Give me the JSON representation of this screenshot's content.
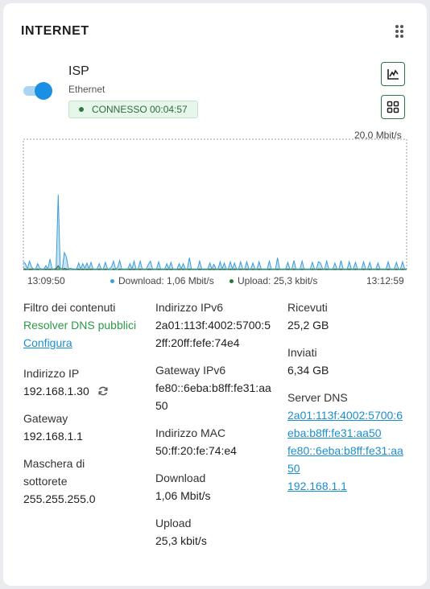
{
  "card": {
    "title": "INTERNET",
    "menu_icon": "more-vertical-icon"
  },
  "connection": {
    "name": "ISP",
    "type": "Ethernet",
    "status": "CONNESSO 00:04:57",
    "enabled": true,
    "colors": {
      "status_text": "#2f6b3e",
      "status_bg": "#e6f6ea",
      "toggle": "#1a8fe3"
    }
  },
  "actions": {
    "chart_icon": "line-chart-icon",
    "grid_icon": "grid-view-icon"
  },
  "chart_data": {
    "type": "area",
    "max_label": "20,0 Mbit/s",
    "ylim": [
      0,
      20
    ],
    "x_start_label": "13:09:50",
    "x_end_label": "13:12:59",
    "legend": [
      {
        "name": "Download: 1,06 Mbit/s",
        "color": "#3b9cdc"
      },
      {
        "name": "Upload: 25,3 kbit/s",
        "color": "#1f7a3c"
      }
    ],
    "series": [
      {
        "name": "Download: 1,06 Mbit/s",
        "values": [
          1.2,
          0.9,
          0.1,
          1.3,
          0.4,
          0.1,
          0.1,
          0.9,
          0.2,
          0.1,
          0.1,
          0.6,
          0.1,
          1.6,
          0.1,
          0.1,
          0.2,
          11.5,
          0.3,
          0.1,
          2.6,
          1.9,
          0.1,
          0.2,
          0.1,
          0.1,
          0.1,
          1.0,
          0.1,
          0.9,
          0.2,
          1.0,
          0.1,
          1.1,
          0.1,
          0.1,
          0.1,
          0.9,
          0.1,
          0.1,
          1.1,
          0.1,
          0.1,
          0.4,
          1.3,
          0.1,
          0.3,
          1.4,
          0.1,
          0.1,
          0.1,
          0.1,
          0.9,
          0.1,
          1.3,
          0.1,
          0.1,
          1.3,
          0.1,
          0.1,
          0.1,
          0.8,
          1.3,
          0.1,
          0.1,
          0.1,
          1.2,
          0.1,
          0.1,
          0.1,
          0.9,
          0.1,
          1.1,
          0.1,
          0.1,
          0.1,
          0.9,
          0.1,
          0.9,
          0.1,
          0.1,
          1.8,
          0.1,
          0.1,
          0.1,
          0.1,
          1.3,
          0.1,
          0.1,
          0.1,
          0.1,
          1.0,
          0.1,
          0.8,
          0.1,
          0.1,
          1.2,
          0.1,
          1.0,
          0.1,
          0.1,
          1.2,
          0.1,
          1.0,
          0.1,
          0.1,
          1.2,
          0.1,
          0.1,
          1.2,
          0.1,
          0.1,
          1.0,
          0.1,
          0.1,
          1.2,
          0.1,
          0.1,
          0.1,
          0.1,
          1.3,
          0.1,
          0.1,
          0.1,
          1.8,
          0.1,
          0.1,
          0.1,
          0.1,
          1.1,
          0.1,
          0.1,
          1.4,
          0.1,
          0.1,
          0.1,
          1.3,
          0.1,
          0.1,
          0.1,
          0.1,
          1.1,
          0.1,
          0.1,
          1.2,
          1.0,
          0.1,
          0.1,
          1.3,
          0.1,
          0.1,
          0.1,
          1.0,
          0.1,
          0.1,
          1.4,
          0.1,
          0.1,
          0.1,
          1.2,
          0.1,
          0.1,
          1.1,
          0.1,
          0.1,
          0.1,
          1.2,
          0.1,
          0.1,
          1.1,
          0.1,
          0.1,
          0.1,
          1.0,
          0.1,
          0.1,
          0.1,
          0.1,
          1.2,
          0.1,
          0.1,
          0.1,
          1.1,
          0.1,
          0.1,
          1.2,
          0.1,
          0.1
        ]
      },
      {
        "name": "Upload: 25,3 kbit/s",
        "values": [
          0.1,
          0.1,
          0.0,
          0.1,
          0.1,
          0.0,
          0.0,
          0.1,
          0.0,
          0.0,
          0.0,
          0.1,
          0.0,
          0.1,
          0.0,
          0.0,
          0.1,
          0.6,
          0.0,
          0.0,
          0.2,
          0.1,
          0.0,
          0.0,
          0.0,
          0.0,
          0.0,
          0.1,
          0.0,
          0.1,
          0.0,
          0.1,
          0.0,
          0.1,
          0.0,
          0.0,
          0.0,
          0.1,
          0.0,
          0.0,
          0.1,
          0.0,
          0.0,
          0.0,
          0.1,
          0.0,
          0.0,
          0.1,
          0.0,
          0.0,
          0.0,
          0.0,
          0.1,
          0.0,
          0.1,
          0.0,
          0.0,
          0.1,
          0.0,
          0.0,
          0.0,
          0.1,
          0.1,
          0.0,
          0.0,
          0.0,
          0.1,
          0.0,
          0.0,
          0.0,
          0.1,
          0.0,
          0.1,
          0.0,
          0.0,
          0.0,
          0.1,
          0.0,
          0.1,
          0.0,
          0.0,
          0.1,
          0.0,
          0.0,
          0.0,
          0.0,
          0.1,
          0.0,
          0.0,
          0.0,
          0.0,
          0.1,
          0.0,
          0.1,
          0.0,
          0.0,
          0.1,
          0.0,
          0.1,
          0.0,
          0.0,
          0.1,
          0.0,
          0.1,
          0.0,
          0.0,
          0.1,
          0.0,
          0.0,
          0.1,
          0.0,
          0.0,
          0.1,
          0.0,
          0.0,
          0.1,
          0.0,
          0.0,
          0.0,
          0.0,
          0.1,
          0.0,
          0.0,
          0.0,
          0.1,
          0.0,
          0.0,
          0.0,
          0.0,
          0.1,
          0.0,
          0.0,
          0.1,
          0.0,
          0.0,
          0.0,
          0.1,
          0.0,
          0.0,
          0.0,
          0.0,
          0.1,
          0.0,
          0.0,
          0.1,
          0.1,
          0.0,
          0.0,
          0.1,
          0.0,
          0.0,
          0.0,
          0.1,
          0.0,
          0.0,
          0.1,
          0.0,
          0.0,
          0.0,
          0.1,
          0.0,
          0.0,
          0.1,
          0.0,
          0.0,
          0.0,
          0.1,
          0.0,
          0.0,
          0.1,
          0.0,
          0.0,
          0.0,
          0.1,
          0.0,
          0.0,
          0.0,
          0.0,
          0.1,
          0.0,
          0.0,
          0.0,
          0.1,
          0.0,
          0.0,
          0.1,
          0.0,
          0.0
        ]
      }
    ]
  },
  "details": {
    "col1": {
      "content_filter": {
        "label": "Filtro dei contenuti",
        "value": "Resolver DNS pubblici",
        "link": "Configura"
      },
      "ip": {
        "label": "Indirizzo IP",
        "value": "192.168.1.30",
        "refresh_icon": "refresh-icon"
      },
      "gateway": {
        "label": "Gateway",
        "value": "192.168.1.1"
      },
      "mask": {
        "label_1": "Maschera di",
        "label_2": "sottorete",
        "value": "255.255.255.0"
      }
    },
    "col2": {
      "ipv6": {
        "label": "Indirizzo IPv6",
        "value_1": "2a01:113f:4002:5700:5",
        "value_2": "2ff:20ff:fefe:74e4"
      },
      "gateway_ipv6": {
        "label": "Gateway IPv6",
        "value_1": "fe80::6eba:b8ff:fe31:aa",
        "value_2": "50"
      },
      "mac": {
        "label": "Indirizzo MAC",
        "value": "50:ff:20:fe:74:e4"
      },
      "download": {
        "label": "Download",
        "value": "1,06 Mbit/s"
      },
      "upload": {
        "label": "Upload",
        "value": "25,3 kbit/s"
      }
    },
    "col3": {
      "received": {
        "label": "Ricevuti",
        "value": "25,2 GB"
      },
      "sent": {
        "label": "Inviati",
        "value": "6,34 GB"
      },
      "dns": {
        "label": "Server DNS",
        "entries": [
          "2a01:113f:4002:5700:6",
          "eba:b8ff:fe31:aa50",
          "fe80::6eba:b8ff:fe31:aa",
          "50",
          "192.168.1.1"
        ]
      }
    }
  }
}
